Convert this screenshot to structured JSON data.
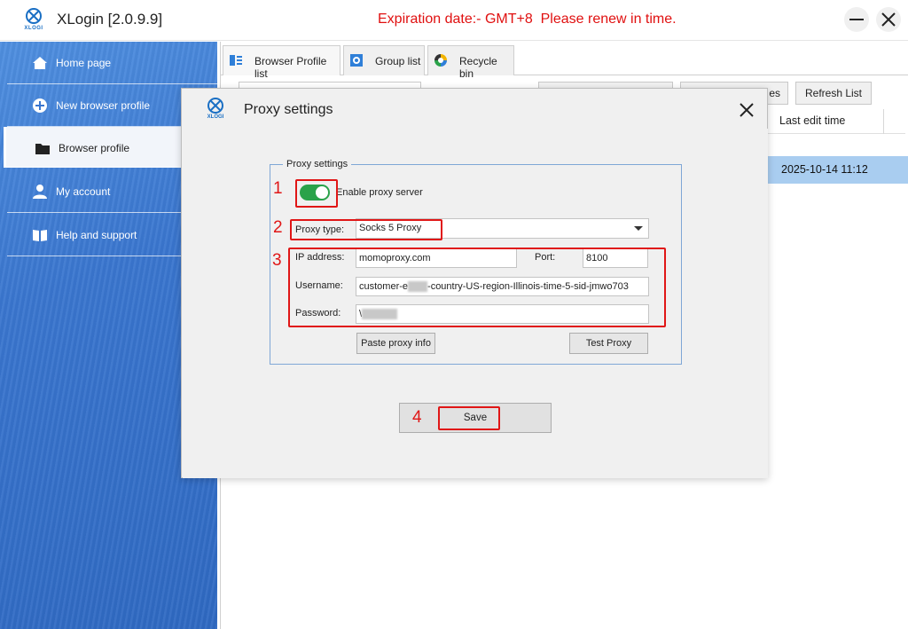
{
  "app": {
    "title": "XLogin [2.0.9.9]",
    "logo_text": "XLOGI",
    "expiry_notice": "Expiration date:- GMT+8  Please renew in time."
  },
  "sidebar": {
    "items": [
      {
        "label": "Home page",
        "icon": "home-icon"
      },
      {
        "label": "New browser profile",
        "icon": "plus-circle-icon"
      },
      {
        "label": "Browser profile",
        "icon": "folder-icon",
        "active": true
      },
      {
        "label": "My account",
        "icon": "user-icon"
      },
      {
        "label": "Help and support",
        "icon": "book-icon"
      }
    ]
  },
  "tabs": [
    {
      "label": "Browser Profile list",
      "icon": "list-icon"
    },
    {
      "label": "Group list",
      "icon": "gear-icon"
    },
    {
      "label": "Recycle bin",
      "icon": "recycle-icon"
    }
  ],
  "toolbar": {
    "partial_button_label": "es",
    "refresh_label": "Refresh List"
  },
  "table": {
    "last_edit_header": "Last edit time",
    "selected_row_time": "2025-10-14 11:12"
  },
  "dialog": {
    "title": "Proxy settings",
    "group_legend": "Proxy settings",
    "enable_label": "Enable proxy server",
    "enabled": true,
    "proxy_type_label": "Proxy type:",
    "proxy_type_value": "Socks 5 Proxy",
    "ip_label": "IP address:",
    "ip_value": "momoproxy.com",
    "port_label": "Port:",
    "port_value": "8100",
    "username_label": "Username:",
    "username_prefix": "customer-e",
    "username_suffix": "-country-US-region-Illinois-time-5-sid-jmwo703",
    "password_label": "Password:",
    "password_prefix": "\\",
    "paste_button": "Paste proxy info",
    "test_button": "Test Proxy",
    "save_button": "Save"
  },
  "annotations": [
    "1",
    "2",
    "3",
    "4"
  ],
  "colors": {
    "sidebar": "#3a76cf",
    "toggle_on": "#2aa24a",
    "annotation_red": "#e01616",
    "expiry_red": "#e01010",
    "selected_row": "#a9cdf0"
  }
}
